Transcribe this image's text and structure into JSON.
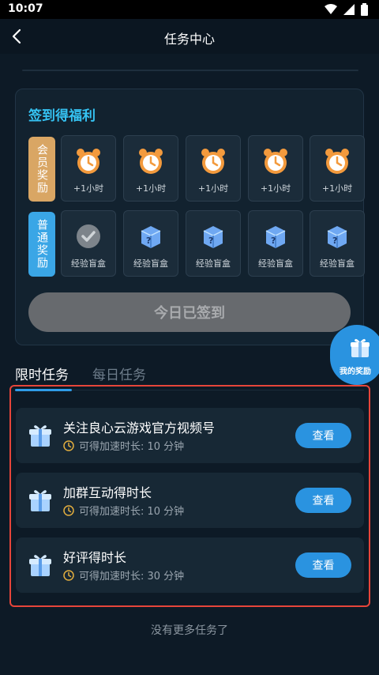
{
  "status_bar": {
    "time": "10:07"
  },
  "app_bar": {
    "title": "任务中心"
  },
  "sign_in": {
    "heading": "签到得福利",
    "vip_label": "会员奖励",
    "normal_label": "普通奖励",
    "vip_rewards": [
      "+1小时",
      "+1小时",
      "+1小时",
      "+1小时",
      "+1小时"
    ],
    "normal_rewards": [
      "经验盲盒",
      "经验盲盒",
      "经验盲盒",
      "经验盲盒",
      "经验盲盒"
    ],
    "button_label": "今日已签到"
  },
  "my_rewards": {
    "label": "我的奖励"
  },
  "tabs": [
    {
      "label": "限时任务",
      "active": true
    },
    {
      "label": "每日任务",
      "active": false
    }
  ],
  "tasks": [
    {
      "title": "关注良心云游戏官方视频号",
      "subtitle": "可得加速时长: 10 分钟",
      "button": "查看"
    },
    {
      "title": "加群互动得时长",
      "subtitle": "可得加速时长: 10 分钟",
      "button": "查看"
    },
    {
      "title": "好评得时长",
      "subtitle": "可得加速时长: 30 分钟",
      "button": "查看"
    }
  ],
  "footer": {
    "no_more": "没有更多任务了"
  },
  "colors": {
    "accent": "#2a93e0",
    "heading": "#35c3f3",
    "vip": "#d9a664",
    "highlight_border": "#e6453a"
  },
  "icons": {
    "back": "back-arrow-icon",
    "vip_reward": "alarm-clock-icon",
    "normal_reward_claimed": "check-icon",
    "normal_reward": "mystery-box-icon",
    "task": "gift-box-icon",
    "time": "clock-icon"
  }
}
